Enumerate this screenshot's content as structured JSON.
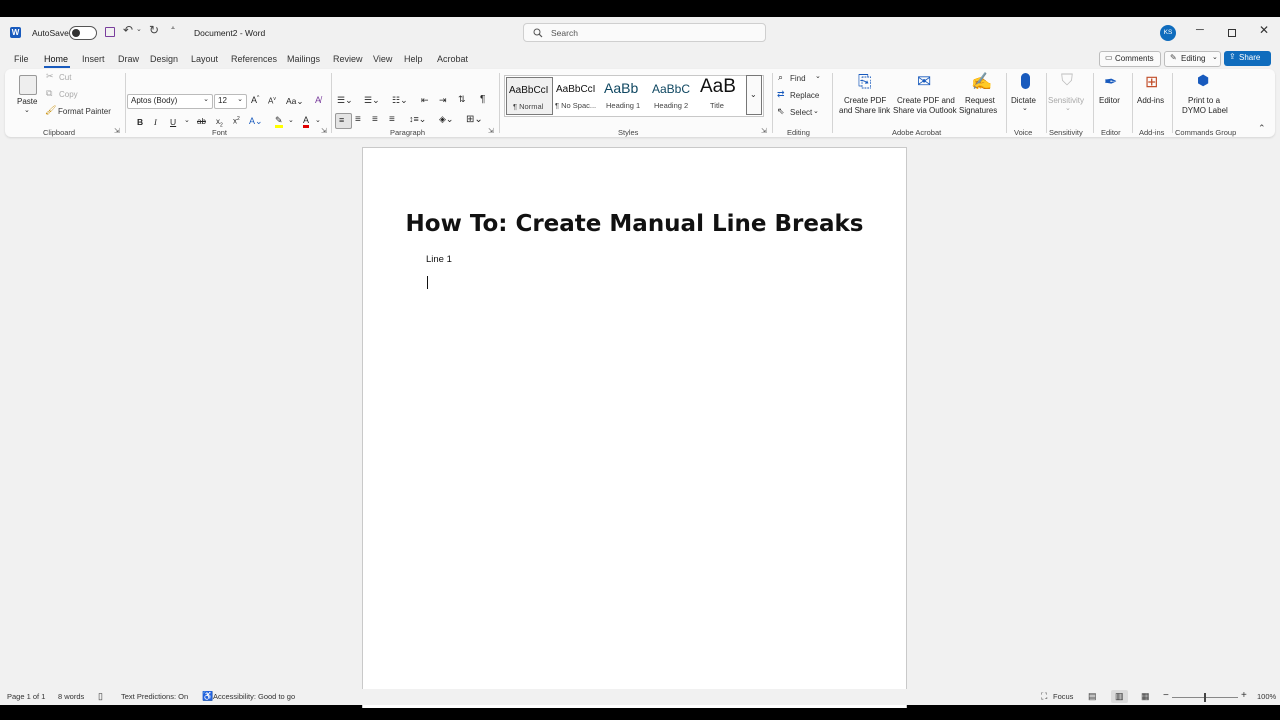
{
  "titlebar": {
    "autosave_label": "AutoSave",
    "doc_title": "Document2 - Word",
    "search_placeholder": "Search",
    "avatar_initials": "KS"
  },
  "menu": {
    "tabs": [
      "File",
      "Home",
      "Insert",
      "Draw",
      "Design",
      "Layout",
      "References",
      "Mailings",
      "Review",
      "View",
      "Help",
      "Acrobat"
    ],
    "comments_label": "Comments",
    "editing_label": "Editing",
    "share_label": "Share"
  },
  "ribbon": {
    "clipboard": {
      "paste": "Paste",
      "cut": "Cut",
      "copy": "Copy",
      "format_painter": "Format Painter",
      "group": "Clipboard"
    },
    "font": {
      "font_name": "Aptos (Body)",
      "font_size": "12",
      "group": "Font"
    },
    "paragraph": {
      "group": "Paragraph"
    },
    "styles": {
      "items": [
        {
          "preview": "AaBbCcI",
          "name": "¶ Normal"
        },
        {
          "preview": "AaBbCcI",
          "name": "¶ No Spac..."
        },
        {
          "preview": "AaBb",
          "name": "Heading 1"
        },
        {
          "preview": "AaBbC",
          "name": "Heading 2"
        },
        {
          "preview": "AaB",
          "name": "Title"
        }
      ],
      "group": "Styles"
    },
    "editing": {
      "find": "Find",
      "replace": "Replace",
      "select": "Select",
      "group": "Editing"
    },
    "acrobat": {
      "create_pdf_l1": "Create PDF",
      "create_pdf_l2": "and Share link",
      "share_outlook_l1": "Create PDF and",
      "share_outlook_l2": "Share via Outlook",
      "request_l1": "Request",
      "request_l2": "Signatures",
      "group": "Adobe Acrobat"
    },
    "voice": {
      "dictate": "Dictate",
      "group": "Voice"
    },
    "sensitivity": {
      "label": "Sensitivity",
      "group": "Sensitivity"
    },
    "editor": {
      "label": "Editor",
      "group": "Editor"
    },
    "addins": {
      "label": "Add-ins",
      "group": "Add-ins"
    },
    "commands": {
      "label_l1": "Print to a",
      "label_l2": "DYMO Label",
      "group": "Commands Group"
    }
  },
  "document": {
    "title": "How To: Create Manual Line Breaks",
    "line1": "Line 1"
  },
  "status": {
    "page": "Page 1 of 1",
    "words": "8 words",
    "predictions": "Text Predictions: On",
    "accessibility": "Accessibility: Good to go",
    "focus": "Focus",
    "zoom": "100%"
  },
  "colors": {
    "word_blue": "#185abd",
    "share_blue": "#0f6cbd",
    "avatar_bg": "#0f6cbd",
    "font_red": "#e00000",
    "highlight_yellow": "#ffff00"
  }
}
